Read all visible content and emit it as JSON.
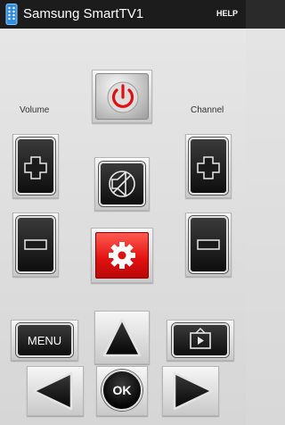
{
  "app": {
    "title": "Samsung SmartTV1",
    "help_label": "HELP",
    "icon": "remote-control-icon"
  },
  "remote": {
    "volume_label": "Volume",
    "channel_label": "Channel",
    "menu_label": "MENU",
    "ok_label": "OK",
    "icons": {
      "power": "power-icon",
      "mute": "mute-icon",
      "settings": "gear-icon",
      "source": "tv-source-icon",
      "up": "arrow-up-icon",
      "left": "arrow-left-icon",
      "right": "arrow-right-icon",
      "plus": "plus-icon",
      "minus": "minus-icon"
    }
  },
  "colors": {
    "power_accent": "#e01010",
    "settings_accent": "#e01010",
    "header_bg": "#1c1c1c"
  }
}
